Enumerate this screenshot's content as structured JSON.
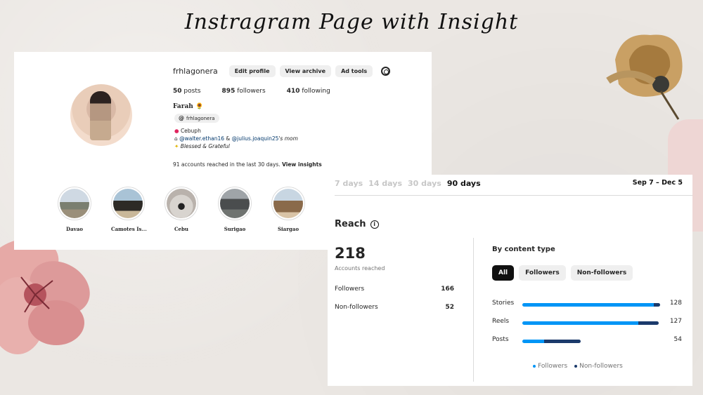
{
  "headline": "Instragram Page with Insight",
  "colors": {
    "followers": "#0095f6",
    "non_followers": "#1b3a6b",
    "button_bg": "#efefef",
    "active_filter_bg": "#111111"
  },
  "icons": [
    "gear-icon",
    "threads-icon",
    "info-icon",
    "location-pin-icon",
    "sparkles-icon",
    "house-icon"
  ],
  "profile": {
    "username": "frhlagonera",
    "buttons": {
      "edit": "Edit profile",
      "archive": "View archive",
      "ads": "Ad tools"
    },
    "stats": {
      "posts": "50",
      "posts_label": "posts",
      "followers": "895",
      "followers_label": "followers",
      "following": "410",
      "following_label": "following"
    },
    "display_name": "Farah 🌻",
    "threads_handle": "frhlagonera",
    "bio": {
      "location": "Cebuph",
      "mention1": "@walter.ethan16",
      "amp": "&",
      "mention2": "@julius.joaquin25",
      "mention_suffix": "'s mom",
      "tagline": "Blessed & Grateful"
    },
    "reach_text": "91 accounts reached in the last 30 days.",
    "reach_link": "View insights",
    "highlights": [
      {
        "label": "Davao"
      },
      {
        "label": "Camotes Is..."
      },
      {
        "label": "Cebu"
      },
      {
        "label": "Surigao"
      },
      {
        "label": "Siargao"
      }
    ]
  },
  "insights": {
    "tabs": [
      "7 days",
      "14 days",
      "30 days",
      "90 days"
    ],
    "active_tab": "90 days",
    "date_range": "Sep 7 – Dec 5",
    "section_title": "Reach",
    "total": "218",
    "total_label": "Accounts reached",
    "split": [
      {
        "label": "Followers",
        "value": "166"
      },
      {
        "label": "Non-followers",
        "value": "52"
      }
    ],
    "content_type_title": "By content type",
    "filters": [
      "All",
      "Followers",
      "Non-followers"
    ],
    "active_filter": "All",
    "legend": [
      "Followers",
      "Non-followers"
    ]
  },
  "chart_data": {
    "type": "bar",
    "orientation": "horizontal",
    "stacked": true,
    "categories": [
      "Stories",
      "Reels",
      "Posts"
    ],
    "totals": [
      128,
      127,
      54
    ],
    "series": [
      {
        "name": "Followers",
        "values": [
          122,
          108,
          20
        ]
      },
      {
        "name": "Non-followers",
        "values": [
          6,
          19,
          34
        ]
      }
    ],
    "xlim": [
      0,
      128
    ],
    "legend_position": "bottom"
  }
}
